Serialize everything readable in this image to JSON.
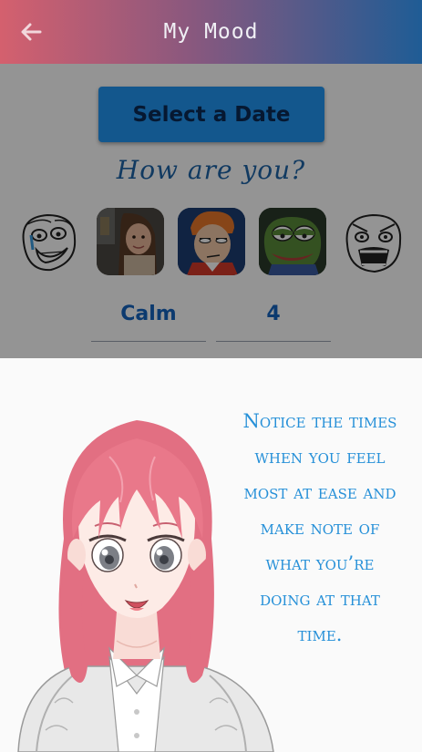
{
  "header": {
    "title": "My Mood",
    "back_icon": "arrow-left-icon",
    "gradient": [
      "#d4606e",
      "#1f5c95"
    ]
  },
  "date_button": {
    "label": "Select a Date"
  },
  "question": "How are you?",
  "moods": [
    {
      "name": "happy-meme-face"
    },
    {
      "name": "disaster-girl-face"
    },
    {
      "name": "fry-squint-face"
    },
    {
      "name": "pepe-frog-face"
    },
    {
      "name": "rage-face"
    }
  ],
  "fields": {
    "mood_value": "Calm",
    "level_value": "4"
  },
  "tip": {
    "text": "Notice the times when you feel most at ease and make note of what you’re doing at that time."
  },
  "colors": {
    "accent": "#2196f3",
    "tip_text": "#2690d8",
    "question_text": "#1e64a8"
  }
}
